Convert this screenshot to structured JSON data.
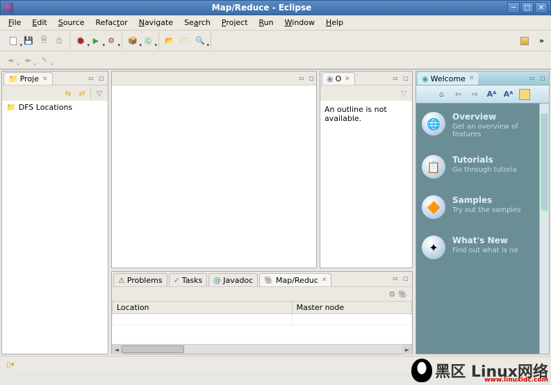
{
  "window": {
    "title": "Map/Reduce - Eclipse"
  },
  "menu": {
    "file": "File",
    "edit": "Edit",
    "source": "Source",
    "refactor": "Refactor",
    "navigate": "Navigate",
    "search": "Search",
    "project": "Project",
    "run": "Run",
    "window": "Window",
    "help": "Help"
  },
  "views": {
    "project_explorer": {
      "tab": "Proje",
      "tree_root": "DFS Locations"
    },
    "outline": {
      "tab": "O",
      "message": "An outline is not available."
    },
    "welcome": {
      "tab": "Welcome",
      "items": [
        {
          "title": "Overview",
          "desc": "Get an overview of features"
        },
        {
          "title": "Tutorials",
          "desc": "Go through tutoria"
        },
        {
          "title": "Samples",
          "desc": "Try out the samples"
        },
        {
          "title": "What's New",
          "desc": "Find out what is ne"
        }
      ]
    }
  },
  "bottom": {
    "tabs": {
      "problems": "Problems",
      "tasks": "Tasks",
      "javadoc": "Javadoc",
      "mapreduce": "Map/Reduc"
    },
    "columns": {
      "location": "Location",
      "master": "Master node"
    }
  },
  "watermark": {
    "zh": "黑区 Linux网络",
    "url": "www.linuxidc.com"
  }
}
